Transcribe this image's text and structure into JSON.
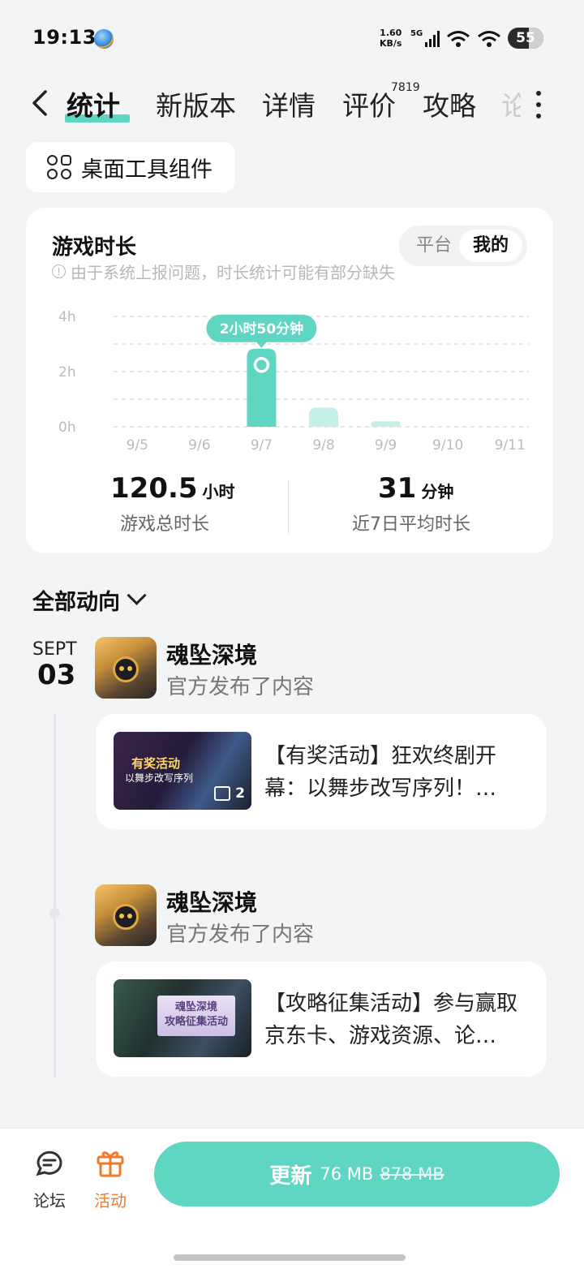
{
  "status": {
    "time": "19:13",
    "speed_top": "1.60",
    "speed_bottom": "KB/s",
    "net": "5G",
    "battery": "55"
  },
  "nav": {
    "tabs": [
      "统计",
      "新版本",
      "详情",
      "评价",
      "攻略",
      "论"
    ],
    "review_badge": "7819"
  },
  "widget_button": {
    "label": "桌面工具组件"
  },
  "stats": {
    "title": "游戏时长",
    "note": "由于系统上报问题，时长统计可能有部分缺失",
    "toggle": {
      "platform": "平台",
      "mine": "我的",
      "selected": "我的"
    },
    "tooltip": "2小时50分钟",
    "total_value": "120.5",
    "total_unit": "小时",
    "total_label": "游戏总时长",
    "avg_value": "31",
    "avg_unit": "分钟",
    "avg_label": "近7日平均时长"
  },
  "chart_data": {
    "type": "bar",
    "categories": [
      "9/5",
      "9/6",
      "9/7",
      "9/8",
      "9/9",
      "9/10",
      "9/11"
    ],
    "values": [
      0,
      0,
      2.83,
      0.7,
      0.2,
      0,
      0
    ],
    "yticks": [
      "0h",
      "2h",
      "4h"
    ],
    "ylim": [
      0,
      4
    ],
    "highlight_index": 2,
    "grid": true,
    "colors": {
      "bar": "#5ed6c1",
      "bar_light": "#c5f0e8"
    }
  },
  "feed": {
    "filter_label": "全部动向",
    "date_month": "SEPT",
    "date_day": "03",
    "posts": [
      {
        "author": "魂坠深境",
        "action": "官方发布了内容",
        "thumb_title": "有奖活动",
        "thumb_sub": "以舞步改写序列",
        "image_count": "2",
        "title": "【有奖活动】狂欢终剧开幕：以舞步改写序列！…"
      },
      {
        "author": "魂坠深境",
        "action": "官方发布了内容",
        "thumb_title": "魂坠深境",
        "thumb_sub": "攻略征集活动",
        "title": "【攻略征集活动】参与赢取京东卡、游戏资源、论…"
      }
    ]
  },
  "bottom_bar": {
    "forum": "论坛",
    "activity": "活动",
    "update_label": "更新",
    "update_size": "76 MB",
    "old_size": "878 MB",
    "accent": "#5ed6c1",
    "activity_color": "#f07a2a"
  }
}
